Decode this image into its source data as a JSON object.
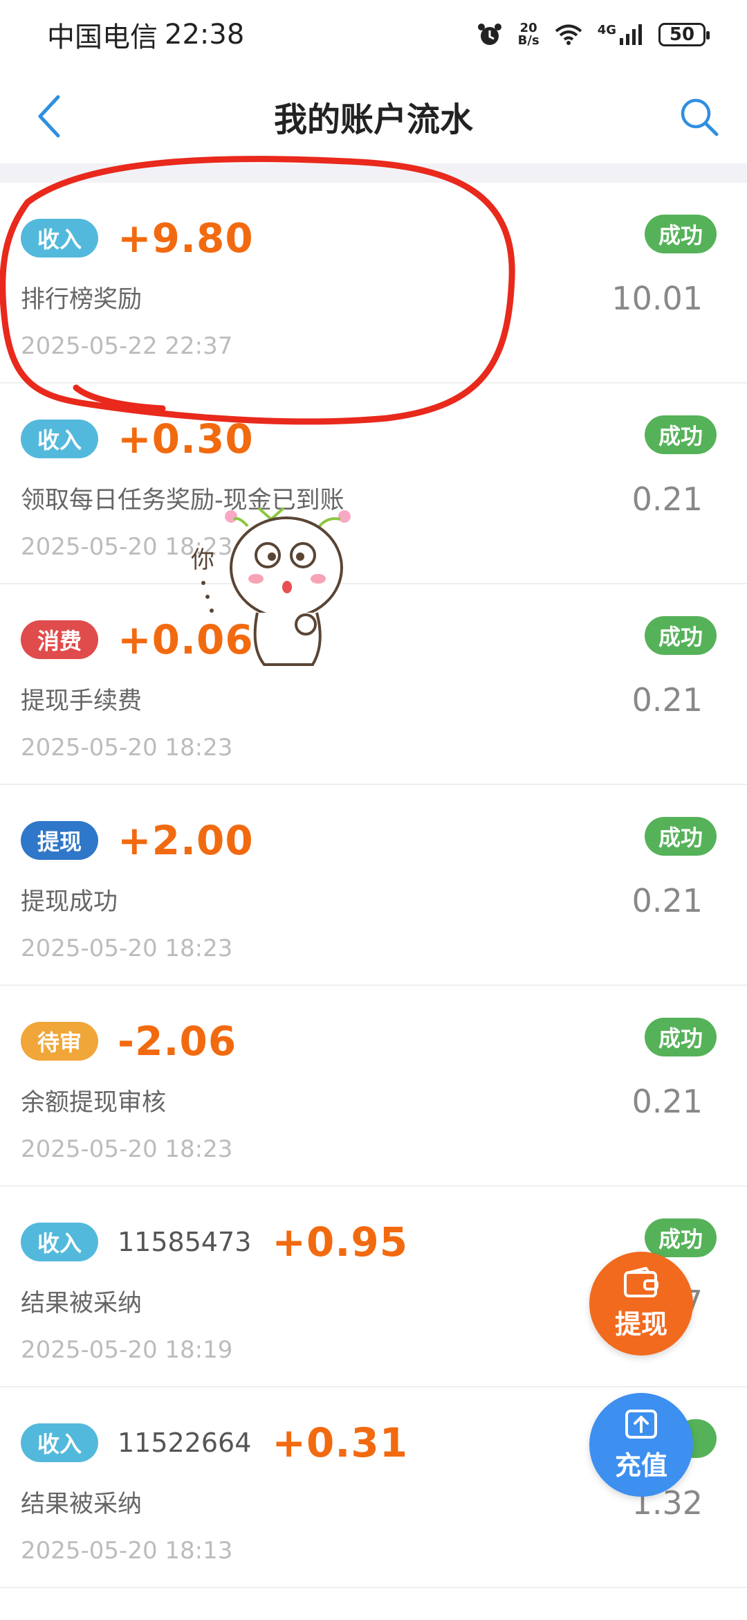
{
  "status_bar": {
    "carrier": "中国电信",
    "time": "22:38",
    "speed_value": "20",
    "speed_unit": "B/s",
    "network": "4G",
    "battery": "50"
  },
  "header": {
    "title": "我的账户流水"
  },
  "records": [
    {
      "tag": "收入",
      "tag_color": "#53b9dc",
      "order_id": "",
      "amount": "+9.80",
      "desc": "排行榜奖励",
      "time": "2025-05-22 22:37",
      "status": "成功",
      "balance": "10.01"
    },
    {
      "tag": "收入",
      "tag_color": "#53b9dc",
      "order_id": "",
      "amount": "+0.30",
      "desc": "领取每日任务奖励-现金已到账",
      "time": "2025-05-20 18:23",
      "status": "成功",
      "balance": "0.21"
    },
    {
      "tag": "消费",
      "tag_color": "#e04b4b",
      "order_id": "",
      "amount": "+0.06",
      "desc": "提现手续费",
      "time": "2025-05-20 18:23",
      "status": "成功",
      "balance": "0.21"
    },
    {
      "tag": "提现",
      "tag_color": "#2f77c9",
      "order_id": "",
      "amount": "+2.00",
      "desc": "提现成功",
      "time": "2025-05-20 18:23",
      "status": "成功",
      "balance": "0.21"
    },
    {
      "tag": "待审",
      "tag_color": "#f0a638",
      "order_id": "",
      "amount": "-2.06",
      "desc": "余额提现审核",
      "time": "2025-05-20 18:23",
      "status": "成功",
      "balance": "0.21"
    },
    {
      "tag": "收入",
      "tag_color": "#53b9dc",
      "order_id": "11585473",
      "amount": "+0.95",
      "desc": "结果被采纳",
      "time": "2025-05-20 18:19",
      "status": "成功",
      "balance": "7"
    },
    {
      "tag": "收入",
      "tag_color": "#53b9dc",
      "order_id": "11522664",
      "amount": "+0.31",
      "desc": "结果被采纳",
      "time": "2025-05-20 18:13",
      "status": "",
      "balance": "1.32"
    }
  ],
  "sticker": {
    "text": "你..."
  },
  "fab": {
    "withdraw_label": "提现",
    "recharge_label": "充值"
  },
  "colors": {
    "amount": "#f26a10",
    "status_success": "#55b259",
    "highlight": "#e8291c",
    "accent": "#2f8fe0"
  }
}
